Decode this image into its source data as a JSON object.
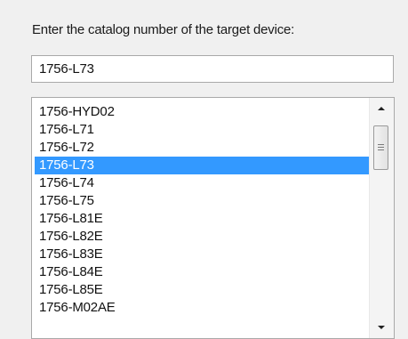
{
  "prompt": {
    "label": "Enter the catalog number of the target device:"
  },
  "entry": {
    "value": "1756-L73"
  },
  "list": {
    "items": [
      "1756-HYD02",
      "1756-L71",
      "1756-L72",
      "1756-L73",
      "1756-L74",
      "1756-L75",
      "1756-L81E",
      "1756-L82E",
      "1756-L83E",
      "1756-L84E",
      "1756-L85E",
      "1756-M02AE"
    ],
    "selected": "1756-L73"
  },
  "colors": {
    "selection": "#3399ff",
    "panel": "#f0f0f0"
  },
  "icons": {
    "scroll_up": "chevron-up-icon",
    "scroll_down": "chevron-down-icon"
  }
}
